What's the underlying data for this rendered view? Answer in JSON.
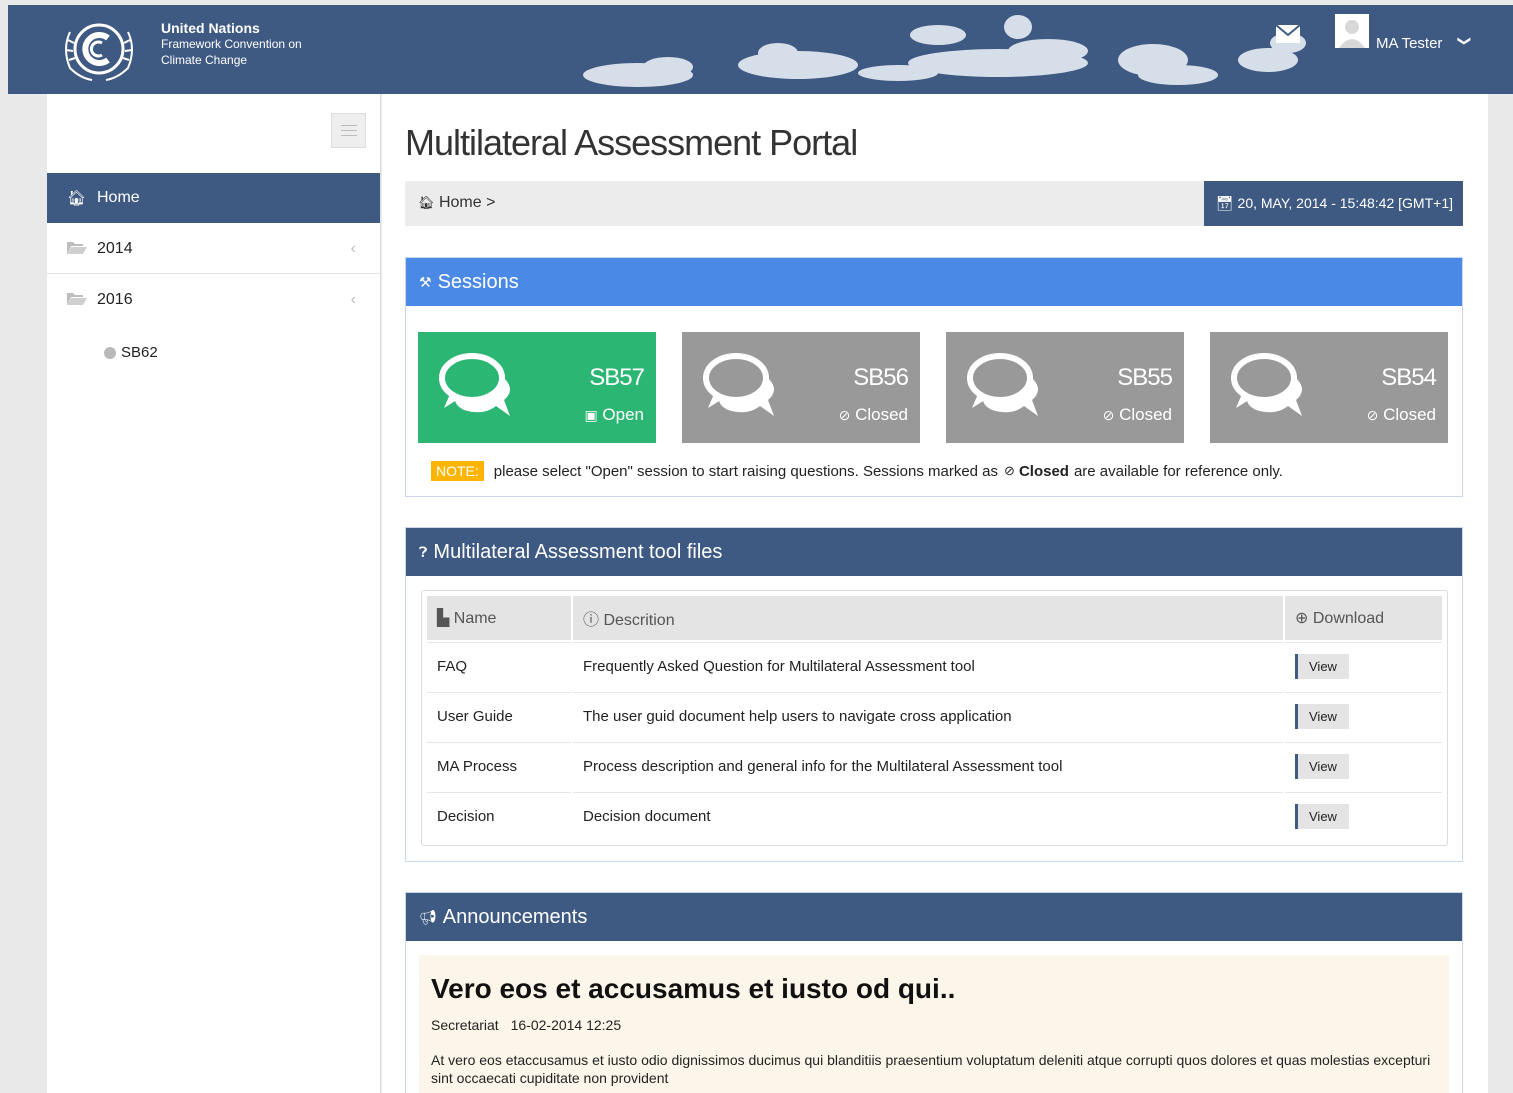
{
  "header": {
    "org_line1": "United Nations",
    "org_line2": "Framework Convention on",
    "org_line3": "Climate Change",
    "user_name": "MA Tester",
    "user_chevron": "❯"
  },
  "sidebar": {
    "items": [
      {
        "label": "Home",
        "icon": "home-icon"
      },
      {
        "label": "2014",
        "icon": "folder-open-icon",
        "arrow": "‹"
      },
      {
        "label": "2016",
        "icon": "folder-open-icon",
        "arrow": "‹"
      }
    ],
    "sub_item": "SB62"
  },
  "main": {
    "title": "Multilateral Assessment Portal",
    "breadcrumb": "Home >",
    "datetime": "20, MAY, 2014 - 15:48:42 [GMT+1]",
    "sessions": {
      "heading": "Sessions",
      "tiles": [
        {
          "code": "SB57",
          "state": "Open"
        },
        {
          "code": "SB56",
          "state": "Closed"
        },
        {
          "code": "SB55",
          "state": "Closed"
        },
        {
          "code": "SB54",
          "state": "Closed"
        }
      ],
      "note_tag": "NOTE:",
      "note_text_1": "please select \"Open\" session to start raising questions. Sessions marked as",
      "note_closed": "Closed",
      "note_text_2": "are available for reference only."
    },
    "files": {
      "heading": "Multilateral Assessment tool files",
      "columns": [
        "Name",
        "Descrition",
        "Download"
      ],
      "rows": [
        {
          "name": "FAQ",
          "desc": "Frequently Asked Question for Multilateral Assessment tool",
          "action": "View"
        },
        {
          "name": "User Guide",
          "desc": "The user guid document help users to navigate cross application",
          "action": "View"
        },
        {
          "name": "MA Process",
          "desc": "Process description and general info for the Multilateral Assessment tool",
          "action": "View"
        },
        {
          "name": "Decision",
          "desc": "Decision document",
          "action": "View"
        }
      ]
    },
    "announcements": {
      "heading": "Announcements",
      "title": "Vero eos et accusamus et iusto od qui..",
      "author": "Secretariat",
      "date": "16-02-2014 12:25",
      "body": "At vero eos etaccusamus et iusto odio dignissimos ducimus qui blanditiis praesentium voluptatum deleniti atque corrupti quos dolores et quas molestias excepturi sint occaecati cupiditate non provident"
    }
  },
  "colors": {
    "navy": "#3f5a82",
    "blue": "#4a8ae6",
    "green": "#2bb673",
    "grey_tile": "#999999",
    "note": "#ffb400"
  }
}
